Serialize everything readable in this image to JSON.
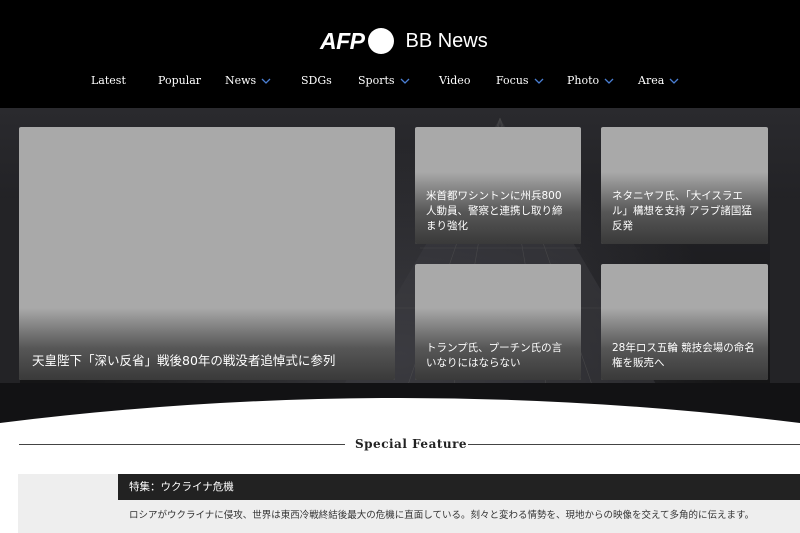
{
  "header": {
    "logo_afp": "AFP",
    "logo_bb": "BB News"
  },
  "nav": {
    "items": [
      {
        "label": "Latest"
      },
      {
        "label": "Popular"
      },
      {
        "label": "News"
      },
      {
        "label": "SDGs"
      },
      {
        "label": "Sports"
      },
      {
        "label": "Video"
      },
      {
        "label": "Focus"
      },
      {
        "label": "Photo"
      },
      {
        "label": "Area"
      }
    ]
  },
  "hero": {
    "main": {
      "caption": "天皇陛下「深い反省」戦後80年の戦没者追悼式に参列"
    },
    "cards": [
      {
        "caption": "米首都ワシントンに州兵800人動員、警察と連携し取り締まり強化"
      },
      {
        "caption": "ネタニヤフ氏、「大イスラエル」構想を支持 アラブ諸国猛反発"
      },
      {
        "caption": "トランプ氏、プーチン氏の言いなりにはならない"
      },
      {
        "caption": "28年ロス五輪 競技会場の命名権を販売へ"
      }
    ]
  },
  "special": {
    "heading": "Special Feature",
    "feature_title": "特集：ウクライナ危機",
    "feature_desc": "ロシアがウクライナに侵攻、世界は東西冷戦終結後最大の危機に直面している。刻々と変わる情勢を、現地からの映像を交えて多角的に伝えます。"
  },
  "colors": {
    "header_bg": "#000000",
    "accent_chevron": "#4a7fd4",
    "card_placeholder": "#a9a9a9",
    "feature_bar": "#222222"
  }
}
